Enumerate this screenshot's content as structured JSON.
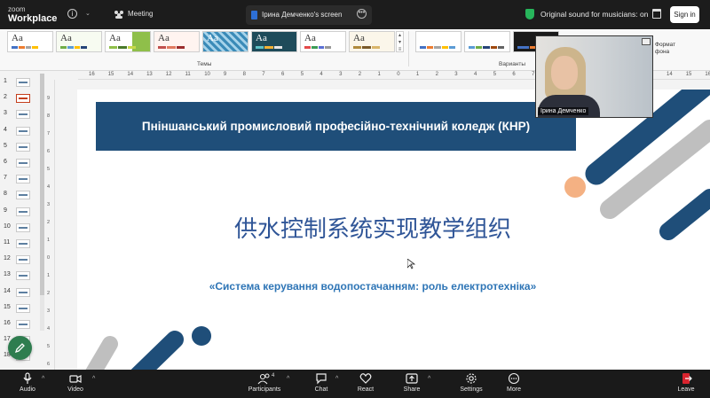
{
  "zoom": {
    "logo_line1": "zoom",
    "logo_line2": "Workplace",
    "meeting_label": "Meeting",
    "shared_screen_label": "Ірина Демченко's screen",
    "original_sound_label": "Original sound for musicians: on",
    "signin_label": "Sign in"
  },
  "powerpoint": {
    "ribbon": {
      "themes_group_label": "Темы",
      "variants_group_label": "Варианты",
      "theme_tile_text": "Aa",
      "format_bg_label_line1": "Формат",
      "format_bg_label_line2": "фона"
    },
    "ruler_h_labels": [
      "16",
      "15",
      "14",
      "13",
      "12",
      "11",
      "10",
      "9",
      "8",
      "7",
      "6",
      "5",
      "4",
      "3",
      "2",
      "1",
      "0",
      "1",
      "2",
      "3",
      "4",
      "5",
      "6",
      "7",
      "8",
      "9",
      "10",
      "11",
      "12",
      "13",
      "14",
      "15",
      "16"
    ],
    "slide_numbers": [
      "1",
      "2",
      "3",
      "4",
      "5",
      "6",
      "7",
      "8",
      "9",
      "10",
      "11",
      "12",
      "13",
      "14",
      "15",
      "16",
      "17",
      "18"
    ],
    "active_slide": 2,
    "slide": {
      "college_name": "Пніншанський промисловий професійно-технічний коледж (КНР)",
      "title_cn": "供水控制系统实现教学组织",
      "subtitle": "«Система керування водопостачанням: роль електротехніка»"
    }
  },
  "participant_video": {
    "name": "Ірина Демченко"
  },
  "toolbar": {
    "audio": "Audio",
    "video": "Video",
    "participants": "Participants",
    "participants_count": "4",
    "chat": "Chat",
    "react": "React",
    "share": "Share",
    "settings": "Settings",
    "more": "More",
    "leave": "Leave"
  },
  "colors": {
    "accent_dark_blue": "#1f4e79",
    "title_blue": "#2f5597",
    "subtitle_blue": "#2e75b6",
    "deco_gray": "#bfbfbf",
    "deco_peach": "#f4b183",
    "zoom_green": "#27b55b",
    "leave_red": "#d9232e"
  }
}
